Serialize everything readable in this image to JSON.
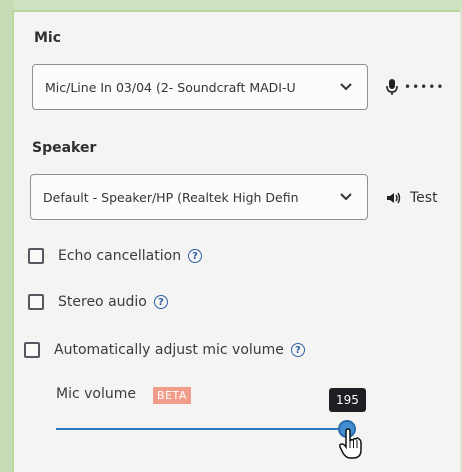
{
  "mic": {
    "label": "Mic",
    "selected_device": "Mic/Line In 03/04 (2- Soundcraft MADI-U",
    "level_indicator": "•••••"
  },
  "speaker": {
    "label": "Speaker",
    "selected_device": "Default - Speaker/HP (Realtek High Defin",
    "test_label": "Test"
  },
  "options": {
    "echo_cancellation": {
      "label": "Echo cancellation",
      "checked": false
    },
    "stereo_audio": {
      "label": "Stereo audio",
      "checked": false
    },
    "auto_adjust": {
      "label": "Automatically adjust mic volume",
      "checked": false
    }
  },
  "mic_volume": {
    "label": "Mic volume",
    "badge": "BETA",
    "value": "195"
  },
  "icons": {
    "help": "?",
    "help_icon_name": "help-circle-icon",
    "mic_icon_name": "microphone-icon",
    "speaker_icon_name": "speaker-icon",
    "chevron_icon_name": "chevron-down-icon",
    "cursor_icon_name": "hand-pointer-icon"
  },
  "colors": {
    "accent": "#2b7ac1",
    "beta_badge": "#f29d8c",
    "help_icon": "#2f5ea8"
  }
}
